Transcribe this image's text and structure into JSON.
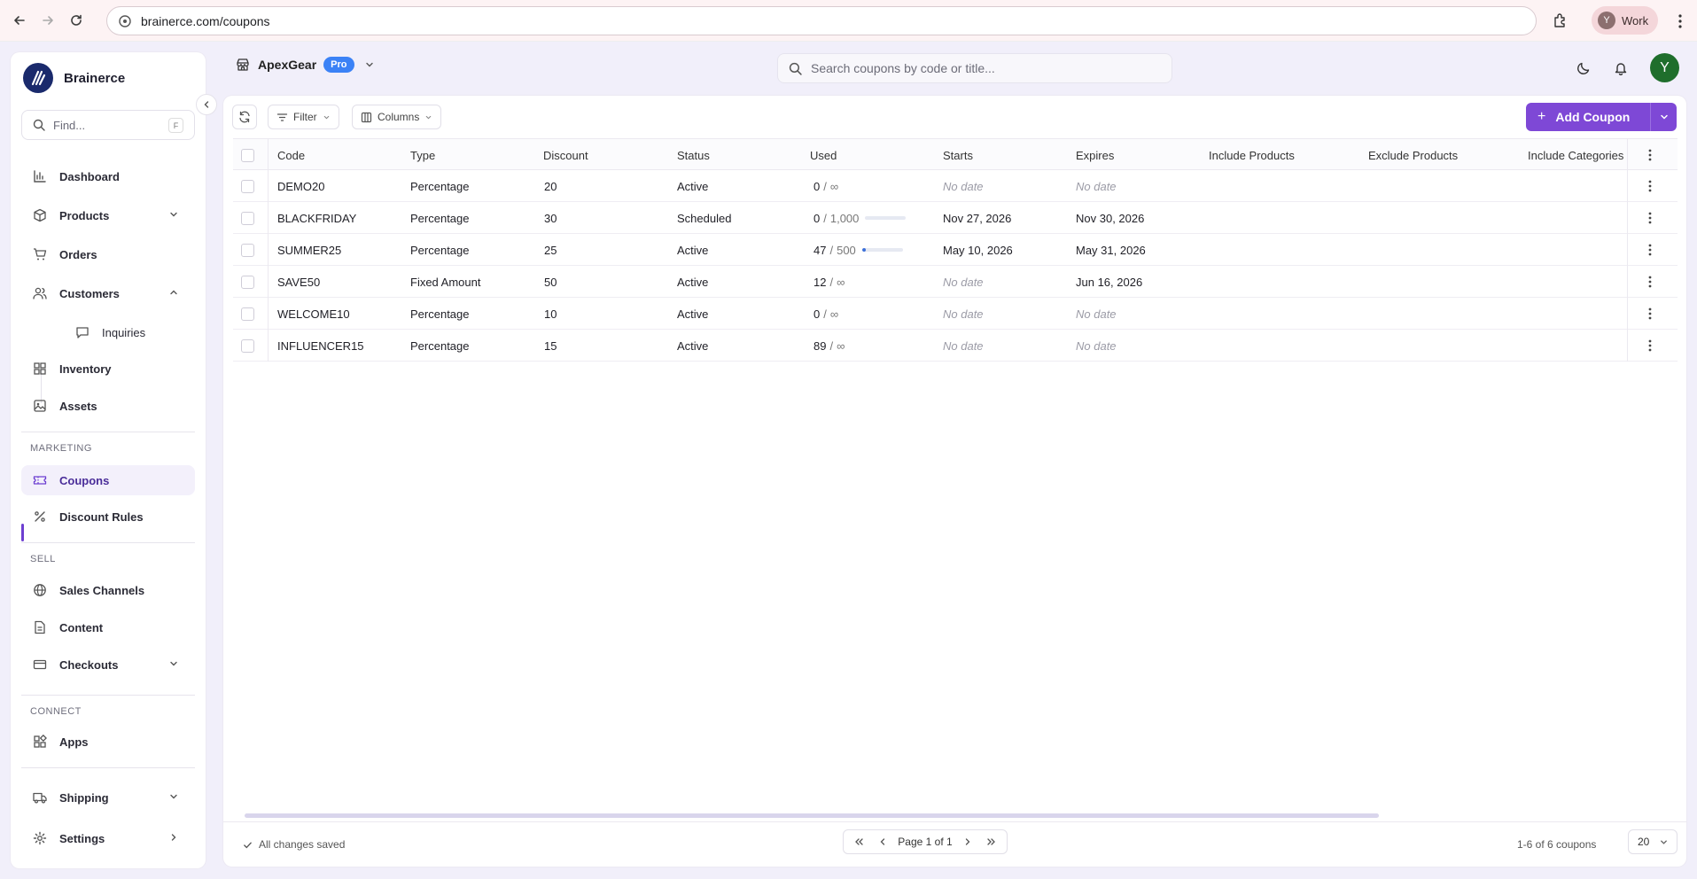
{
  "browser": {
    "url": "brainerce.com/coupons",
    "profile_initial": "Y",
    "profile_name": "Work"
  },
  "sidebar": {
    "brand_name": "Brainerce",
    "find_placeholder": "Find...",
    "find_shortcut": "F",
    "items": [
      {
        "label": "Dashboard",
        "icon": "bar-chart-icon"
      },
      {
        "label": "Products",
        "icon": "box-icon",
        "expandable": true
      },
      {
        "label": "Orders",
        "icon": "cart-icon"
      },
      {
        "label": "Customers",
        "icon": "users-icon",
        "expanded": true
      },
      {
        "label": "Inquiries",
        "icon": "message-icon"
      },
      {
        "label": "Inventory",
        "icon": "grid-icon"
      },
      {
        "label": "Assets",
        "icon": "image-icon"
      },
      {
        "label": "Coupons",
        "icon": "ticket-icon",
        "active": true
      },
      {
        "label": "Discount Rules",
        "icon": "percent-icon"
      },
      {
        "label": "Sales Channels",
        "icon": "globe-icon"
      },
      {
        "label": "Content",
        "icon": "file-icon"
      },
      {
        "label": "Checkouts",
        "icon": "card-icon",
        "expandable": true
      },
      {
        "label": "Apps",
        "icon": "apps-icon"
      },
      {
        "label": "Shipping",
        "icon": "truck-icon",
        "expandable": true
      },
      {
        "label": "Settings",
        "icon": "gear-icon"
      }
    ],
    "sections": {
      "marketing": "MARKETING",
      "sell": "SELL",
      "connect": "CONNECT"
    }
  },
  "header": {
    "store_name": "ApexGear",
    "plan_badge": "Pro",
    "search_placeholder": "Search coupons by code or title...",
    "user_initial": "Y"
  },
  "toolbar": {
    "filter_label": "Filter",
    "columns_label": "Columns",
    "add_label": "Add Coupon"
  },
  "table": {
    "columns": [
      "Code",
      "Type",
      "Discount",
      "Status",
      "Used",
      "Starts",
      "Expires",
      "Include Products",
      "Exclude Products",
      "Include Categories"
    ],
    "rows": [
      {
        "code": "DEMO20",
        "type": "Percentage",
        "discount": "20",
        "status": "Active",
        "used": "0",
        "limit": "∞",
        "progress": null,
        "starts": "No date",
        "expires": "No date"
      },
      {
        "code": "BLACKFRIDAY",
        "type": "Percentage",
        "discount": "30",
        "status": "Scheduled",
        "used": "0",
        "limit": "1,000",
        "progress": 0.0,
        "starts": "Nov 27, 2026",
        "expires": "Nov 30, 2026"
      },
      {
        "code": "SUMMER25",
        "type": "Percentage",
        "discount": "25",
        "status": "Active",
        "used": "47",
        "limit": "500",
        "progress": 0.094,
        "starts": "May 10, 2026",
        "expires": "May 31, 2026"
      },
      {
        "code": "SAVE50",
        "type": "Fixed Amount",
        "discount": "50",
        "status": "Active",
        "used": "12",
        "limit": "∞",
        "progress": null,
        "starts": "No date",
        "expires": "Jun 16, 2026"
      },
      {
        "code": "WELCOME10",
        "type": "Percentage",
        "discount": "10",
        "status": "Active",
        "used": "0",
        "limit": "∞",
        "progress": null,
        "starts": "No date",
        "expires": "No date"
      },
      {
        "code": "INFLUENCER15",
        "type": "Percentage",
        "discount": "15",
        "status": "Active",
        "used": "89",
        "limit": "∞",
        "progress": null,
        "starts": "No date",
        "expires": "No date"
      }
    ]
  },
  "footer": {
    "saved_text": "All changes saved",
    "page_text": "Page 1 of 1",
    "count_text": "1-6 of 6 coupons",
    "page_size": "20"
  },
  "colors": {
    "accent": "#7e48d6",
    "badge_blue": "#3b82f6",
    "avatar_green": "#1f6e2c"
  }
}
